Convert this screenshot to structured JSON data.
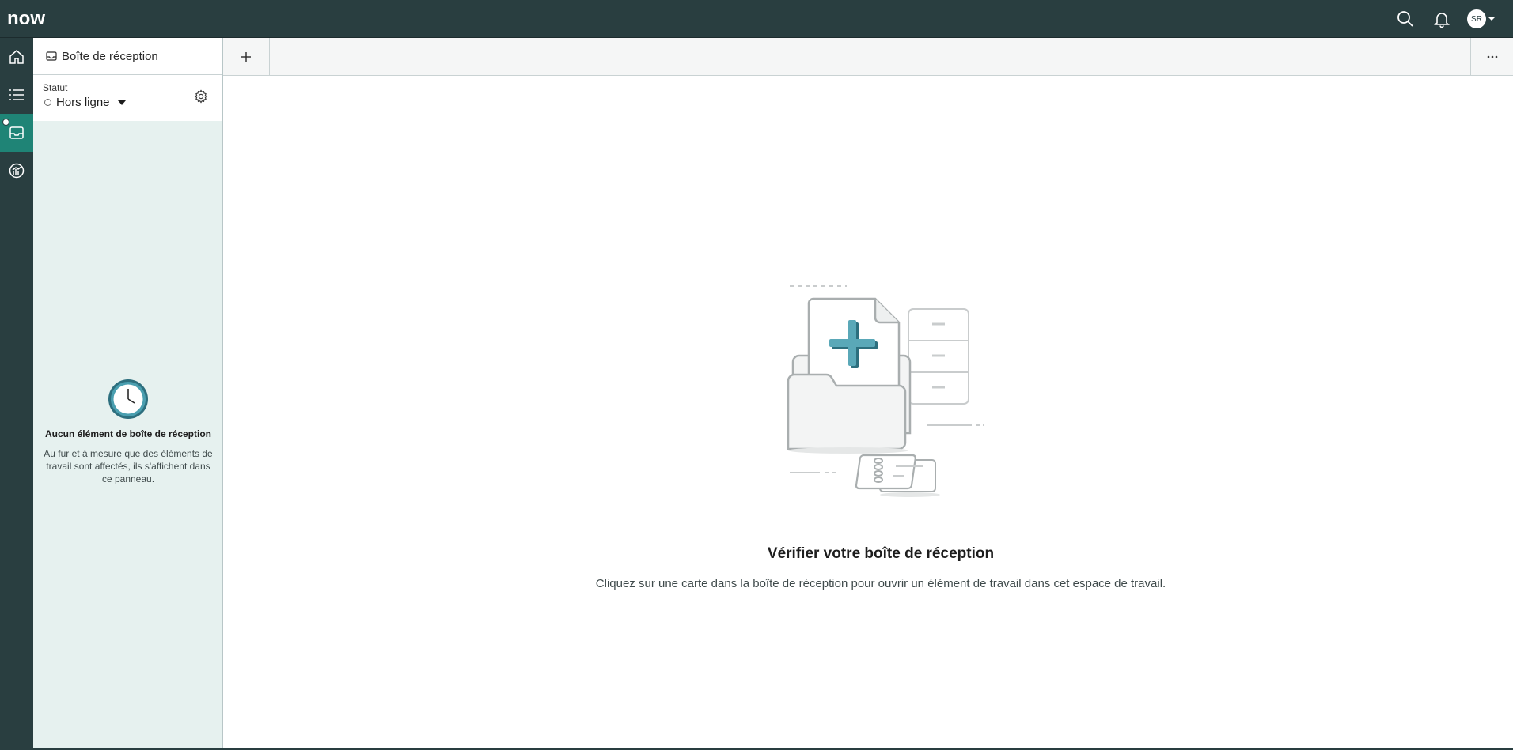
{
  "header": {
    "logo_text": "now",
    "avatar_initials": "SR",
    "icons": [
      "search-icon",
      "bell-icon",
      "chevron-down-icon"
    ]
  },
  "rail": {
    "items": [
      {
        "name": "home-icon"
      },
      {
        "name": "list-icon"
      },
      {
        "name": "inbox-icon",
        "active": true
      },
      {
        "name": "analytics-icon"
      }
    ]
  },
  "panel": {
    "tab_label": "Boîte de réception",
    "status_label": "Statut",
    "status_value": "Hors ligne",
    "empty_title": "Aucun élément de boîte de réception",
    "empty_desc": "Au fur et à mesure que des éléments de travail sont affectés, ils s'affichent dans ce panneau."
  },
  "tabstrip": {
    "new_tab_symbol": "+",
    "more_symbol": "···"
  },
  "workspace": {
    "title": "Vérifier votre boîte de réception",
    "description": "Cliquez sur une carte dans la boîte de réception pour ouvrir un élément de travail dans cet espace de travail."
  },
  "colors": {
    "header_bg": "#293e40",
    "rail_active": "#1f8476",
    "panel_bg": "#e6f1ef",
    "clock_accent": "#4a9fb0"
  }
}
